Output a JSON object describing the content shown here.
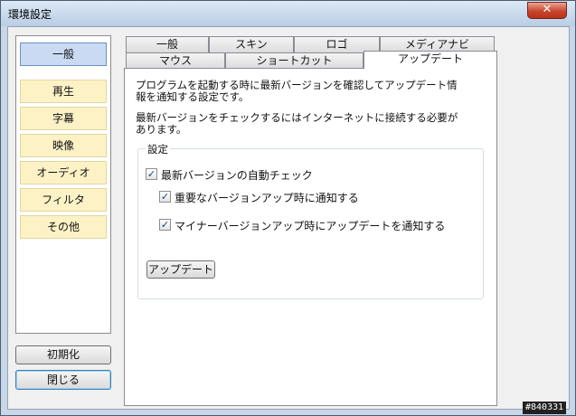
{
  "window": {
    "title": "環境設定",
    "close_glyph": "✕"
  },
  "sidebar": {
    "items": [
      {
        "label": "一般",
        "active": true
      },
      {
        "label": "再生"
      },
      {
        "label": "字幕"
      },
      {
        "label": "映像"
      },
      {
        "label": "オーディオ"
      },
      {
        "label": "フィルタ"
      },
      {
        "label": "その他"
      }
    ]
  },
  "buttons": {
    "reset": "初期化",
    "close": "閉じる"
  },
  "tabs": {
    "row1": [
      "一般",
      "スキン",
      "ロゴ",
      "メディアナビ"
    ],
    "row2": [
      "マウス",
      "ショートカット",
      "アップデート"
    ],
    "active": "アップデート"
  },
  "panel": {
    "desc1_line1": "プログラムを起動する時に最新バージョンを確認してアップデート情",
    "desc1_line2": "報を通知する設定です。",
    "desc2_line1": "最新バージョンをチェックするにはインターネットに接続する必要が",
    "desc2_line2": "あります。",
    "group_label": "設定",
    "check_auto": {
      "label": "最新バージョンの自動チェック",
      "checked": true
    },
    "check_major": {
      "label": "重要なバージョンアップ時に通知する",
      "checked": true
    },
    "check_minor": {
      "label": "マイナーバージョンアップ時にアップデートを通知する",
      "checked": true
    },
    "update_button": "アップデート",
    "check_glyph": "✓"
  },
  "corner_badge": "#840331"
}
